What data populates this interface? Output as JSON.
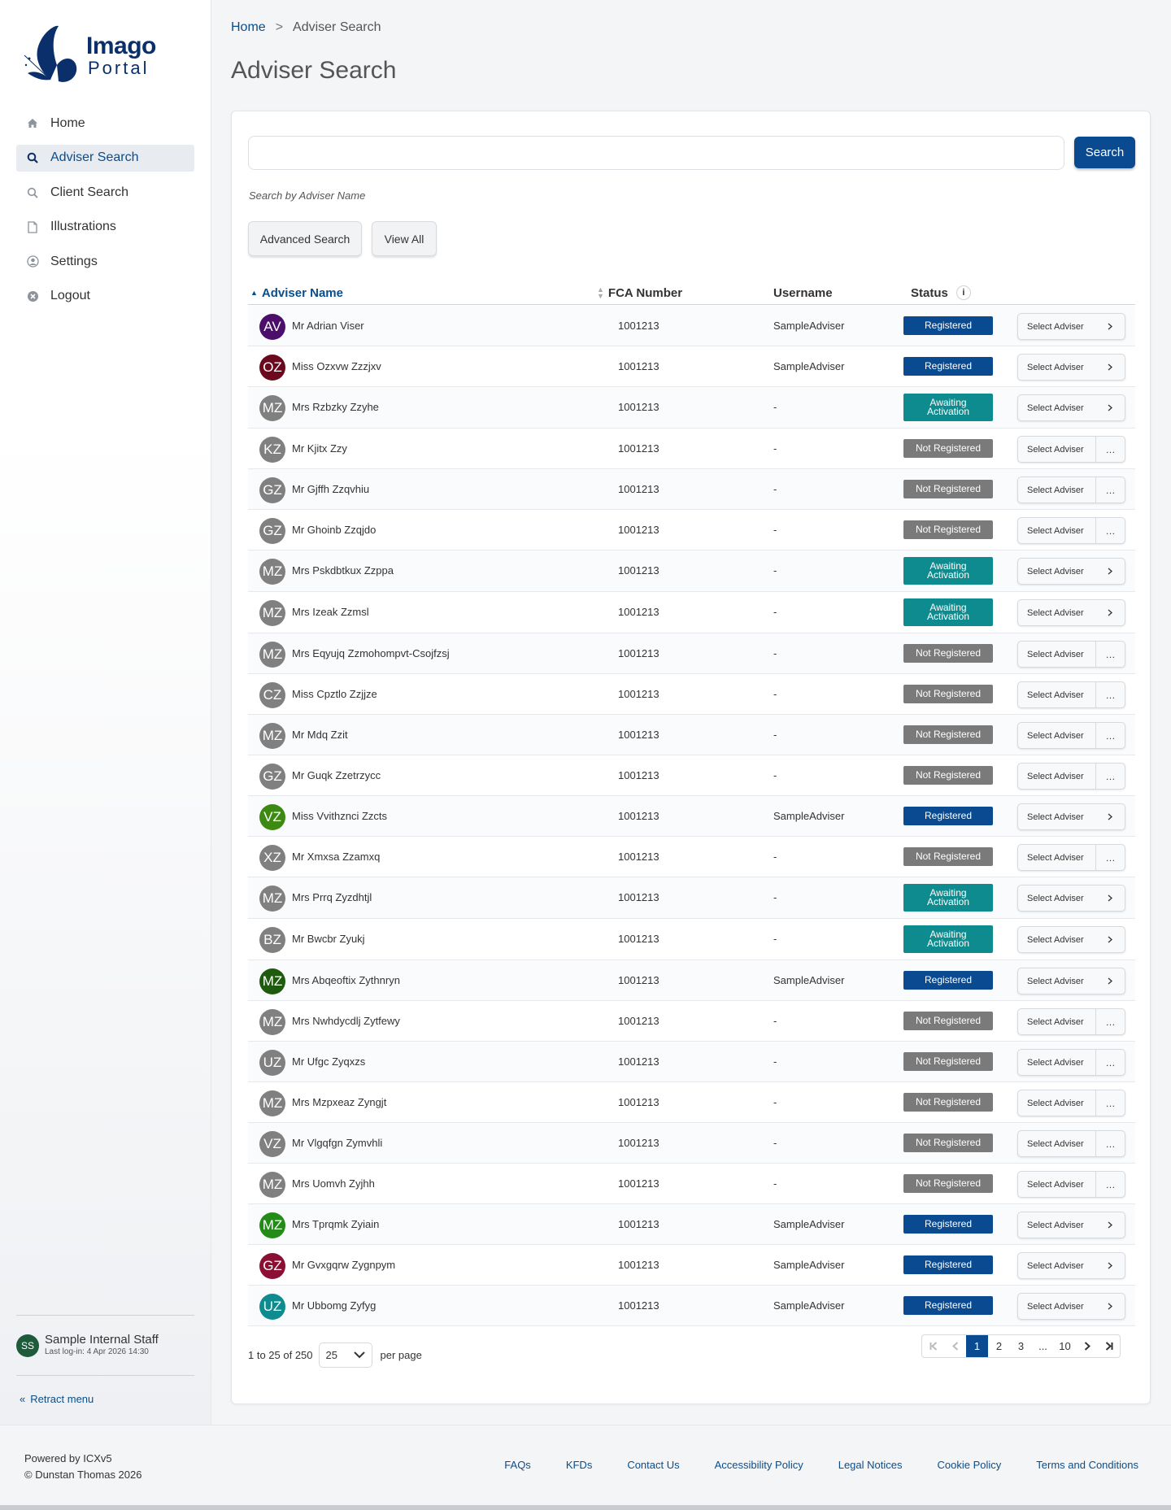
{
  "brand": {
    "line1": "Imago",
    "line2": "Portal"
  },
  "nav": [
    {
      "label": "Home",
      "icon": "home-icon"
    },
    {
      "label": "Adviser Search",
      "icon": "search-icon"
    },
    {
      "label": "Client Search",
      "icon": "search-icon"
    },
    {
      "label": "Illustrations",
      "icon": "document-icon"
    },
    {
      "label": "Settings",
      "icon": "user-circle-icon"
    },
    {
      "label": "Logout",
      "icon": "close-circle-icon"
    }
  ],
  "user": {
    "initials": "SS",
    "name": "Sample Internal Staff",
    "last_login": "Last log-in: 4 Apr 2026 14:30"
  },
  "retract_label": "Retract menu",
  "breadcrumb": {
    "home": "Home",
    "sep": ">",
    "current": "Adviser Search"
  },
  "page_title": "Adviser Search",
  "search": {
    "value": "",
    "placeholder": "",
    "button": "Search",
    "hint": "Search by Adviser Name"
  },
  "actions": {
    "advanced": "Advanced Search",
    "view_all": "View All"
  },
  "columns": {
    "name": "Adviser Name",
    "fca": "FCA Number",
    "username": "Username",
    "status": "Status"
  },
  "status_colors": {
    "Registered": "#0a4a90",
    "Awaiting Activation": "#0d8b8e",
    "Not Registered": "#7a7a7a"
  },
  "select_label": "Select Adviser",
  "rows": [
    {
      "initials": "AV",
      "color": "#4b0f6b",
      "name": "Mr Adrian Viser",
      "fca": "1001213",
      "username": "SampleAdviser",
      "status": "Registered"
    },
    {
      "initials": "OZ",
      "color": "#6b0a1e",
      "name": "Miss Ozxvw Zzzjxv",
      "fca": "1001213",
      "username": "SampleAdviser",
      "status": "Registered"
    },
    {
      "initials": "MZ",
      "color": "#808080",
      "name": "Mrs Rzbzky Zzyhe",
      "fca": "1001213",
      "username": "-",
      "status": "Awaiting Activation"
    },
    {
      "initials": "KZ",
      "color": "#808080",
      "name": "Mr Kjitx Zzy",
      "fca": "1001213",
      "username": "-",
      "status": "Not Registered"
    },
    {
      "initials": "GZ",
      "color": "#808080",
      "name": "Mr Gjffh Zzqvhiu",
      "fca": "1001213",
      "username": "-",
      "status": "Not Registered"
    },
    {
      "initials": "GZ",
      "color": "#808080",
      "name": "Mr Ghoinb Zzqjdo",
      "fca": "1001213",
      "username": "-",
      "status": "Not Registered"
    },
    {
      "initials": "MZ",
      "color": "#808080",
      "name": "Mrs Pskdbtkux Zzppa",
      "fca": "1001213",
      "username": "-",
      "status": "Awaiting Activation"
    },
    {
      "initials": "MZ",
      "color": "#808080",
      "name": "Mrs Izeak Zzmsl",
      "fca": "1001213",
      "username": "-",
      "status": "Awaiting Activation"
    },
    {
      "initials": "MZ",
      "color": "#808080",
      "name": "Mrs Eqyujq Zzmohompvt-Csojfzsj",
      "fca": "1001213",
      "username": "-",
      "status": "Not Registered"
    },
    {
      "initials": "CZ",
      "color": "#808080",
      "name": "Miss Cpztlo Zzjjze",
      "fca": "1001213",
      "username": "-",
      "status": "Not Registered"
    },
    {
      "initials": "MZ",
      "color": "#808080",
      "name": "Mr Mdq Zzit",
      "fca": "1001213",
      "username": "-",
      "status": "Not Registered"
    },
    {
      "initials": "GZ",
      "color": "#808080",
      "name": "Mr Guqk Zzetrzycc",
      "fca": "1001213",
      "username": "-",
      "status": "Not Registered"
    },
    {
      "initials": "VZ",
      "color": "#3d8a12",
      "name": "Miss Vvithznci Zzcts",
      "fca": "1001213",
      "username": "SampleAdviser",
      "status": "Registered"
    },
    {
      "initials": "XZ",
      "color": "#808080",
      "name": "Mr Xmxsa Zzamxq",
      "fca": "1001213",
      "username": "-",
      "status": "Not Registered"
    },
    {
      "initials": "MZ",
      "color": "#808080",
      "name": "Mrs Prrq Zyzdhtjl",
      "fca": "1001213",
      "username": "-",
      "status": "Awaiting Activation"
    },
    {
      "initials": "BZ",
      "color": "#808080",
      "name": "Mr Bwcbr Zyukj",
      "fca": "1001213",
      "username": "-",
      "status": "Awaiting Activation"
    },
    {
      "initials": "MZ",
      "color": "#1f5b0f",
      "name": "Mrs Abqeoftix Zythnryn",
      "fca": "1001213",
      "username": "SampleAdviser",
      "status": "Registered"
    },
    {
      "initials": "MZ",
      "color": "#808080",
      "name": "Mrs Nwhdycdlj Zytfewy",
      "fca": "1001213",
      "username": "-",
      "status": "Not Registered"
    },
    {
      "initials": "UZ",
      "color": "#808080",
      "name": "Mr Ufgc Zyqxzs",
      "fca": "1001213",
      "username": "-",
      "status": "Not Registered"
    },
    {
      "initials": "MZ",
      "color": "#808080",
      "name": "Mrs Mzpxeaz Zyngjt",
      "fca": "1001213",
      "username": "-",
      "status": "Not Registered"
    },
    {
      "initials": "VZ",
      "color": "#808080",
      "name": "Mr Vlgqfgn Zymvhli",
      "fca": "1001213",
      "username": "-",
      "status": "Not Registered"
    },
    {
      "initials": "MZ",
      "color": "#808080",
      "name": "Mrs Uomvh Zyjhh",
      "fca": "1001213",
      "username": "-",
      "status": "Not Registered"
    },
    {
      "initials": "MZ",
      "color": "#238c16",
      "name": "Mrs Tprqmk Zyiain",
      "fca": "1001213",
      "username": "SampleAdviser",
      "status": "Registered"
    },
    {
      "initials": "GZ",
      "color": "#8a0f33",
      "name": "Mr Gvxgqrw Zygnpym",
      "fca": "1001213",
      "username": "SampleAdviser",
      "status": "Registered"
    },
    {
      "initials": "UZ",
      "color": "#0d8b8e",
      "name": "Mr Ubbomg Zyfyg",
      "fca": "1001213",
      "username": "SampleAdviser",
      "status": "Registered"
    }
  ],
  "pagination": {
    "range": "1 to 25 of 250",
    "per_page_value": "25",
    "per_page_label": "per page",
    "pages": [
      "1",
      "2",
      "3",
      "...",
      "10"
    ],
    "current": "1"
  },
  "footer": {
    "powered": "Powered by ICXv5",
    "copyright": "© Dunstan Thomas 2026",
    "links": [
      "FAQs",
      "KFDs",
      "Contact Us",
      "Accessibility Policy",
      "Legal Notices",
      "Cookie Policy",
      "Terms and Conditions"
    ]
  }
}
